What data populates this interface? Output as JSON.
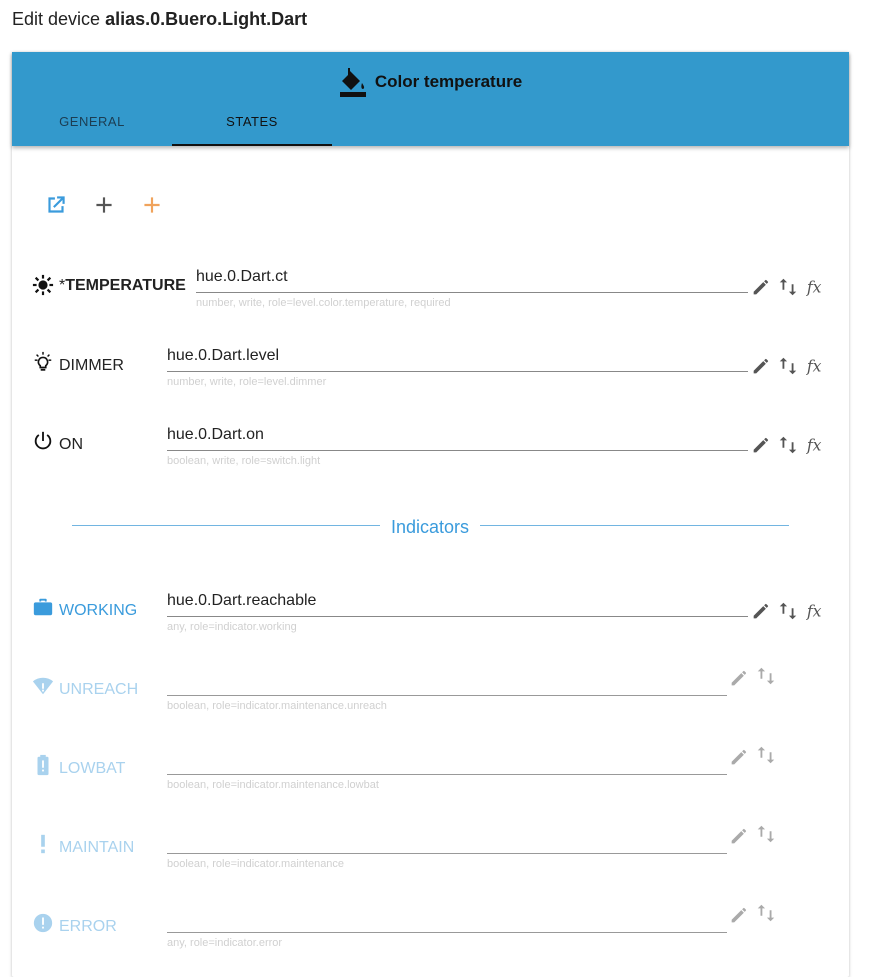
{
  "page": {
    "title_prefix": "Edit device",
    "title_device": "alias.0.Buero.Light.Dart"
  },
  "header": {
    "icon": "paint-bucket-icon",
    "title": "Color temperature",
    "tabs": [
      {
        "label": "GENERAL"
      },
      {
        "label": "STATES",
        "active": true
      }
    ]
  },
  "toolbar": {
    "icons": [
      "open-in-new-icon",
      "plus-icon",
      "plus-orange-icon"
    ],
    "accent": "#3399cc"
  },
  "states": [
    {
      "icon": "sun-icon",
      "prefix": "*",
      "label": "TEMPERATURE",
      "value": "hue.0.Dart.ct",
      "hint": "number, write, role=level.color.temperature, required"
    },
    {
      "icon": "lightbulb-icon",
      "label": "DIMMER",
      "value": "hue.0.Dart.level",
      "hint": "number, write, role=level.dimmer"
    },
    {
      "icon": "power-icon",
      "label": "ON",
      "value": "hue.0.Dart.on",
      "hint": "boolean, write, role=switch.light"
    }
  ],
  "divider": {
    "label": "Indicators"
  },
  "indicators": [
    {
      "icon": "briefcase-icon",
      "label": "WORKING",
      "value": "hue.0.Dart.reachable",
      "hint": "any, role=indicator.working"
    },
    {
      "icon": "wifi-alert-icon",
      "label": "UNREACH",
      "value": "",
      "hint": "boolean, role=indicator.maintenance.unreach"
    },
    {
      "icon": "battery-alert-icon",
      "label": "LOWBAT",
      "value": "",
      "hint": "boolean, role=indicator.maintenance.lowbat"
    },
    {
      "icon": "exclamation-icon",
      "label": "MAINTAIN",
      "value": "",
      "hint": "boolean, role=indicator.maintenance"
    },
    {
      "icon": "error-circle-icon",
      "label": "ERROR",
      "value": "",
      "hint": "any, role=indicator.error"
    }
  ],
  "colors": {
    "header": "#3399cc",
    "indicator_active": "#3a9bdc",
    "indicator_disabled": "#a9d2ee",
    "hint": "#d0d0d0"
  }
}
